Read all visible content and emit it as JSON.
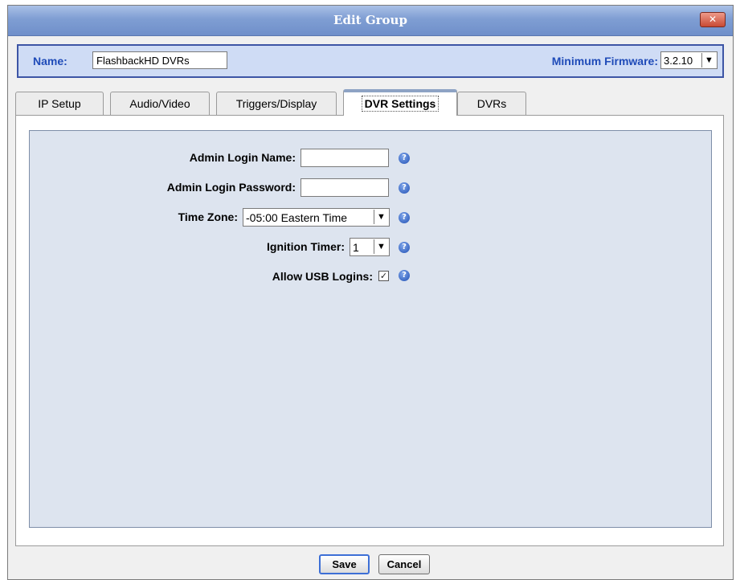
{
  "window": {
    "title": "Edit Group",
    "close_icon": "close-icon"
  },
  "header": {
    "name_label": "Name:",
    "name_value": "FlashbackHD DVRs",
    "firmware_label": "Minimum Firmware:",
    "firmware_value": "3.2.10"
  },
  "tabs": [
    {
      "label": "IP Setup"
    },
    {
      "label": "Audio/Video"
    },
    {
      "label": "Triggers/Display"
    },
    {
      "label": "DVR Settings",
      "active": true
    },
    {
      "label": "DVRs"
    }
  ],
  "form": {
    "admin_login_name_label": "Admin Login Name:",
    "admin_login_name_value": "",
    "admin_login_password_label": "Admin Login Password:",
    "admin_login_password_value": "",
    "time_zone_label": "Time Zone:",
    "time_zone_value": "-05:00 Eastern Time",
    "ignition_timer_label": "Ignition Timer:",
    "ignition_timer_value": "1",
    "allow_usb_label": "Allow USB Logins:",
    "allow_usb_checked": true,
    "help_glyph": "?",
    "check_glyph": "✓",
    "dropdown_glyph": "▼"
  },
  "buttons": {
    "save": "Save",
    "cancel": "Cancel"
  },
  "colors": {
    "title_bar": "#7f9ed3",
    "header_bg": "#cfdcf5",
    "label_blue": "#1f4bb8",
    "panel_bg": "#dde4ef"
  }
}
